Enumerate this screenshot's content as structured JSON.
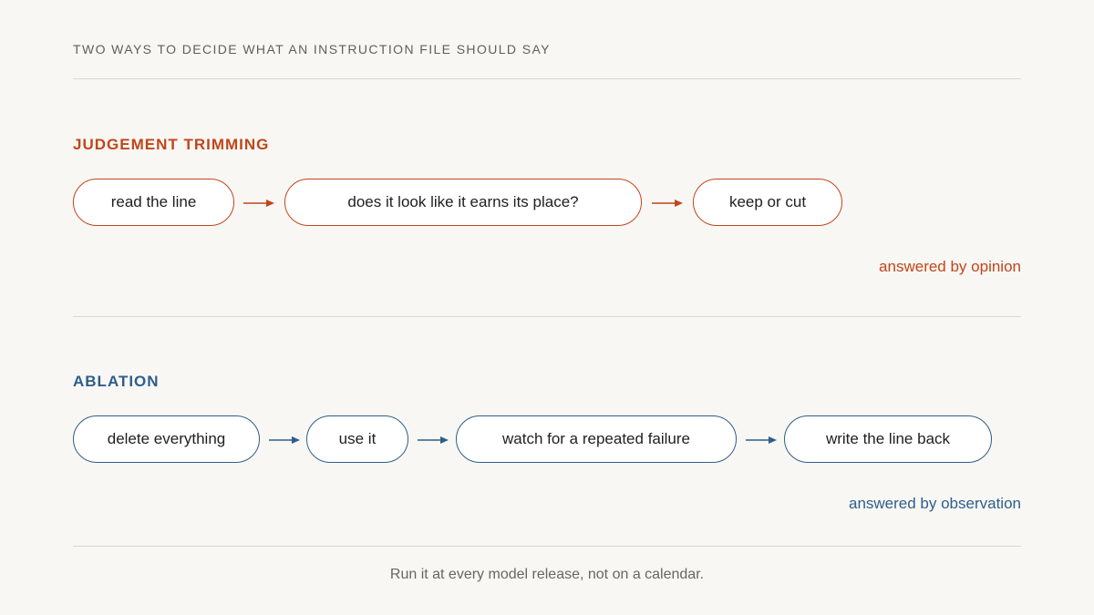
{
  "title": "TWO WAYS TO DECIDE WHAT AN INSTRUCTION FILE SHOULD SAY",
  "colors": {
    "trimming_accent": "#c0461b",
    "ablation_accent": "#2e5e8c",
    "background": "#f8f7f4"
  },
  "trimming": {
    "heading": "JUDGEMENT TRIMMING",
    "steps": [
      "read the line",
      "does it look like it earns its place?",
      "keep or cut"
    ],
    "answer": "answered by opinion"
  },
  "ablation": {
    "heading": "ABLATION",
    "steps": [
      "delete everything",
      "use it",
      "watch for a repeated failure",
      "write the line back"
    ],
    "answer": "answered by observation"
  },
  "footer": "Run it at every model release, not on a calendar."
}
